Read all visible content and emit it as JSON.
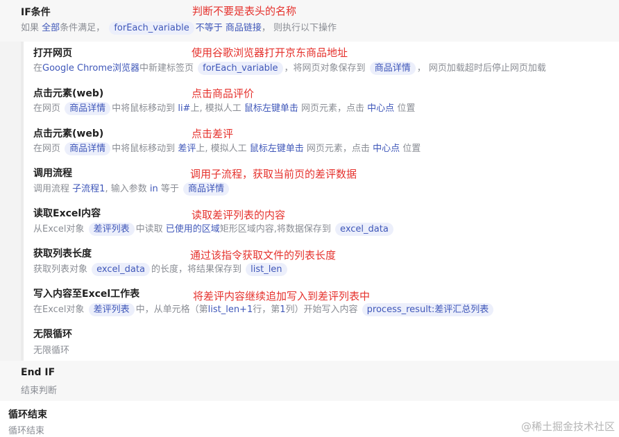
{
  "if_block": {
    "title": "IF条件",
    "desc_p1": "如果",
    "desc_all": "全部",
    "desc_p2": "条件满足，",
    "desc_var": "forEach_variable",
    "desc_op": "不等于",
    "desc_link": "商品链接",
    "desc_p3": "，  则执行以下操作",
    "annotation": "判断不要是表头的名称"
  },
  "steps": [
    {
      "title": "打开网页",
      "annotation": "使用谷歌浏览器打开京东商品地址",
      "parts": {
        "p1": "在",
        "k1": "Google Chrome浏览器",
        "p2": "中新建标签页",
        "v1": "forEach_variable",
        "p3": "，将网页对象保存到",
        "v2": "商品详情",
        "p4": "，  网页加载超时后停止网页加载"
      }
    },
    {
      "title": "点击元素(web)",
      "annotation": "点击商品评价",
      "parts": {
        "p1": "在网页",
        "v1": "商品详情",
        "p2": "中将鼠标移动到",
        "k1": "li#",
        "p3": "上, 模拟人工",
        "k2": "鼠标左键单击",
        "p4": "网页元素，点击",
        "k3": "中心点",
        "p5": "位置"
      }
    },
    {
      "title": "点击元素(web)",
      "annotation": "点击差评",
      "parts": {
        "p1": "在网页",
        "v1": "商品详情",
        "p2": "中将鼠标移动到",
        "k1": "差评",
        "p3": "上, 模拟人工",
        "k2": "鼠标左键单击",
        "p4": "网页元素，点击",
        "k3": "中心点",
        "p5": "位置"
      }
    },
    {
      "title": "调用流程",
      "annotation": "调用子流程，获取当前页的差评数据",
      "parts": {
        "p1": "调用流程",
        "k1": "子流程1",
        "p2": ", 输入参数",
        "k2": "in",
        "p3": "等于",
        "v1": "商品详情"
      }
    },
    {
      "title": "读取Excel内容",
      "annotation": "读取差评列表的内容",
      "parts": {
        "p1": "从Excel对象",
        "v1": "差评列表",
        "p2": "中读取",
        "k1": "已使用的区域",
        "p3": "矩形区域内容,将数据保存到",
        "v2": "excel_data"
      }
    },
    {
      "title": "获取列表长度",
      "annotation": "通过该指令获取文件的列表长度",
      "parts": {
        "p1": "获取列表对象",
        "v1": "excel_data",
        "p2": "的长度，将结果保存到",
        "v2": "list_len"
      }
    },
    {
      "title": "写入内容至Excel工作表",
      "annotation": "将差评内容继续追加写入到差评列表中",
      "parts": {
        "p1": "在Excel对象",
        "v1": "差评列表",
        "p2": "中，从单元格（第",
        "k1": "list_len+1",
        "p3": "行，第",
        "k2": "1",
        "p4": "列）开始写入内容",
        "v2": "process_result:差评汇总列表"
      }
    },
    {
      "title": "无限循环",
      "annotation": "",
      "parts": {
        "p1": "无限循环"
      }
    }
  ],
  "end_if": {
    "title": "End IF",
    "desc": "结束判断"
  },
  "loop_end": {
    "title": "循环结束",
    "desc": "循环结束"
  },
  "watermark": "@稀土掘金技术社区",
  "colors": {
    "keyword": "#3f57b9",
    "pill_bg": "#eceffb",
    "annotation": "#e5322d",
    "if_row_bg": "#f7f7f7",
    "indent_bar": "#e8e8e8"
  }
}
